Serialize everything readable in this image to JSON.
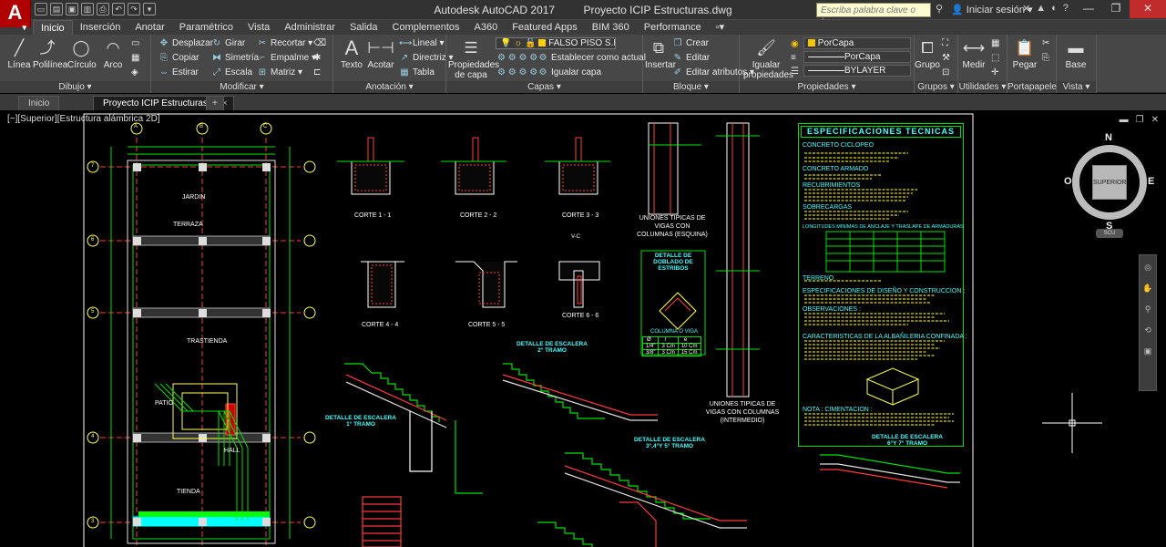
{
  "window": {
    "app_title": "Autodesk AutoCAD 2017",
    "doc_title": "Proyecto ICIP Estructuras.dwg",
    "search_placeholder": "Escriba palabra clave o frase",
    "signin": "Iniciar sesión"
  },
  "ribbon_tabs": [
    "Inicio",
    "Inserción",
    "Anotar",
    "Paramétrico",
    "Vista",
    "Administrar",
    "Salida",
    "Complementos",
    "A360",
    "Featured Apps",
    "BIM 360",
    "Performance"
  ],
  "active_ribbon_tab": "Inicio",
  "panels": {
    "dibujo": {
      "title": "Dibujo",
      "tools": [
        "Línea",
        "Polilínea",
        "Círculo",
        "Arco"
      ]
    },
    "modificar": {
      "title": "Modificar",
      "tools": [
        "Desplazar",
        "Girar",
        "Recortar",
        "Copiar",
        "Simetría",
        "Empalme",
        "Estirar",
        "Escala",
        "Matriz"
      ]
    },
    "anotacion": {
      "title": "Anotación",
      "tools": [
        "Texto",
        "Acotar",
        "Lineal",
        "Directriz",
        "Tabla"
      ]
    },
    "capas": {
      "title": "Capas",
      "big": "Propiedades de capa",
      "layer": "FALSO PISO S.H. 2",
      "set_current": "Establecer como actual",
      "match_layer": "Igualar capa"
    },
    "bloque": {
      "title": "Bloque",
      "big": "Insertar",
      "tools": [
        "Crear",
        "Editar",
        "Editar atributos"
      ]
    },
    "propiedades": {
      "title": "Propiedades",
      "big": "Igualar propiedades",
      "color": "PorCapa",
      "linetype": "PorCapa",
      "lineweight": "BYLAYER"
    },
    "grupos": {
      "title": "Grupos",
      "big": "Grupo"
    },
    "utilidades": {
      "title": "Utilidades",
      "big": "Medir"
    },
    "portapapeles": {
      "title": "Portapapeles",
      "big": "Pegar"
    },
    "vista": {
      "title": "Vista",
      "big": "Base"
    }
  },
  "doc_tabs": [
    "Inicio",
    "Proyecto ICIP Estructuras*"
  ],
  "viewport_label": "[−][Superior][Estructura alámbrica 2D]",
  "viewcube": {
    "n": "N",
    "s": "S",
    "e": "E",
    "w": "O",
    "face": "SUPERIOR",
    "ucs": "SCU"
  },
  "drawing": {
    "spec_title": "ESPECIFICACIONES TECNICAS",
    "spec_sections": [
      "CONCRETO CICLOPEO",
      "CONCRETO ARMADO",
      "RECUBRIMIENTOS",
      "SOBRECARGAS",
      "LONGITUDES MINIMAS DE ANCLAJE Y TRASLAPE DE ARMADURAS",
      "TERRENO",
      "ESPECIFICACIONES DE DISEÑO Y CONSTRUCCION :",
      "OBSERVACIONES :",
      "CARACTERISTICAS DE LA ALBAÑILERIA CONFINADA :",
      "NOTA : CIMENTACION :"
    ],
    "cortes": [
      "CORTE 1 - 1",
      "CORTE 2 - 2",
      "CORTE 3 - 3",
      "CORTE 4 - 4",
      "CORTE 5 - 5",
      "CORTE 6 - 6"
    ],
    "unions_corner": "UNIONES TIPICAS DE VIGAS CON COLUMNAS (ESQUINA)",
    "unions_mid": "UNIONES TIPICAS DE VIGAS CON COLUMNAS (INTERMEDIO)",
    "stirrup_detail": "DETALLE DE DOBLADO DE ESTRIBOS",
    "stirrup_table": {
      "header": [
        "Ø",
        "r",
        "e"
      ],
      "rows": [
        [
          "1/4\"",
          "3 Cm",
          "10 Cm"
        ],
        [
          "3/8\"",
          "3 Cm",
          "15 Cm"
        ]
      ]
    },
    "column_or_beam": "COLUMNA O VIGA",
    "vc": "V-C",
    "stairs": [
      "DETALLE DE ESCALERA 2° TRAMO",
      "DETALLE DE ESCALERA 1° TRAMO",
      "DETALLE DE ESCALERA 3°,4°Y 5° TRAMO",
      "DETALLE DE ESCALERA 6°Y 7° TRAMO"
    ],
    "grid_axes": [
      "A",
      "B",
      "C"
    ],
    "grid_rows": [
      "7",
      "6",
      "5",
      "4",
      "3"
    ],
    "plan_labels": [
      "JARDIN",
      "TERRAZA",
      "TRASTIENDA",
      "PATIO",
      "HALL",
      "TIENDA"
    ]
  }
}
